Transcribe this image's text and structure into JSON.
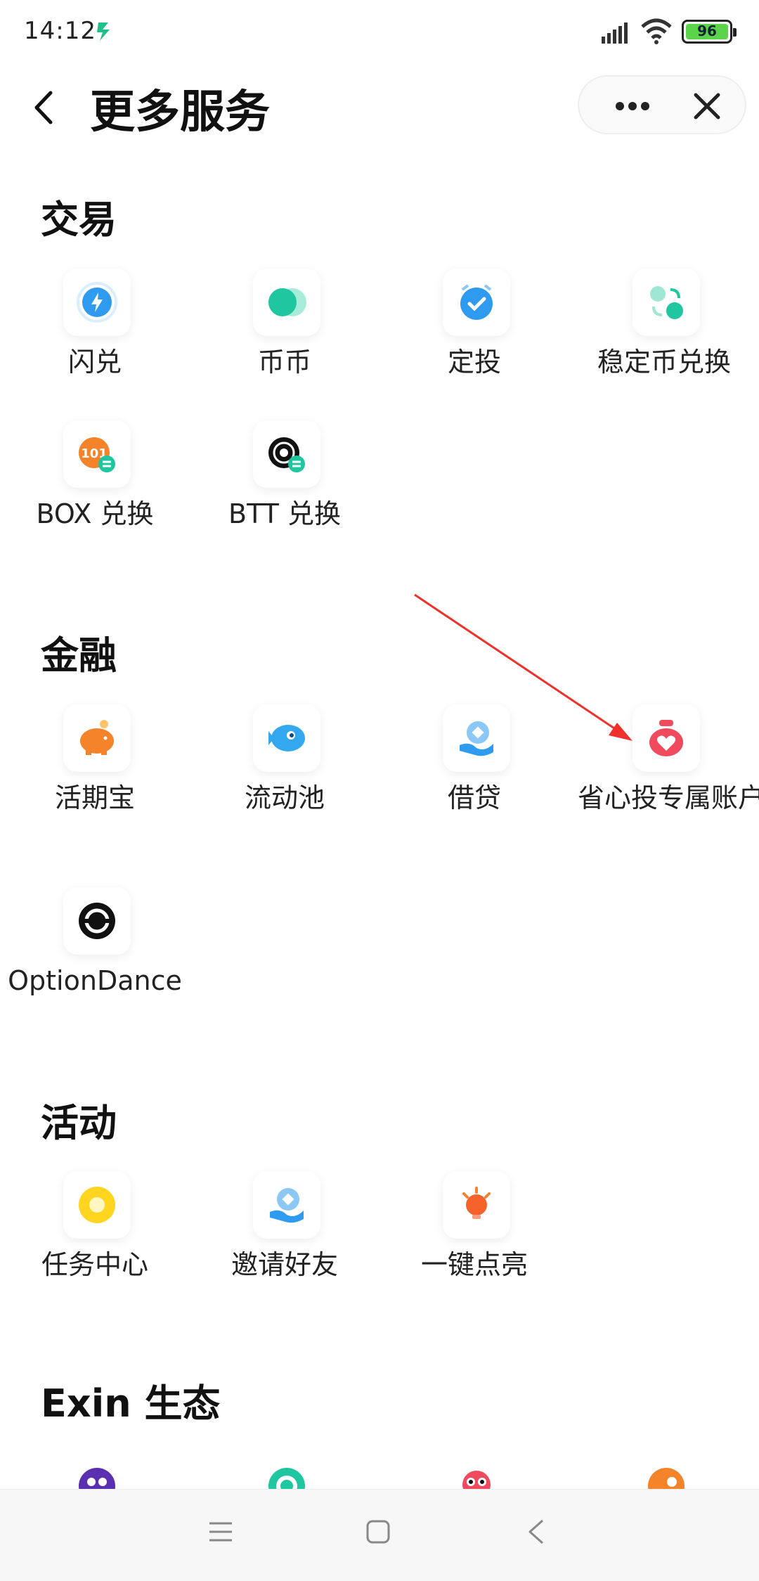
{
  "status_bar": {
    "time": "14:12",
    "battery": "96"
  },
  "header": {
    "title": "更多服务"
  },
  "sections": [
    {
      "title": "交易",
      "items": [
        {
          "label": "闪兑",
          "icon": "flash-swap-icon"
        },
        {
          "label": "币币",
          "icon": "coin-coin-icon"
        },
        {
          "label": "定投",
          "icon": "auto-invest-icon"
        },
        {
          "label": "稳定币兑换",
          "icon": "stablecoin-swap-icon"
        },
        {
          "label": "BOX 兑换",
          "icon": "box-swap-icon"
        },
        {
          "label": "BTT 兑换",
          "icon": "btt-swap-icon"
        }
      ]
    },
    {
      "title": "金融",
      "items": [
        {
          "label": "活期宝",
          "icon": "piggy-bank-icon"
        },
        {
          "label": "流动池",
          "icon": "liquidity-pool-icon"
        },
        {
          "label": "借贷",
          "icon": "lending-icon"
        },
        {
          "label": "省心投专属账户",
          "icon": "money-bag-icon"
        },
        {
          "label": "OptionDance",
          "icon": "optiondance-icon"
        }
      ]
    },
    {
      "title": "活动",
      "items": [
        {
          "label": "任务中心",
          "icon": "task-center-icon"
        },
        {
          "label": "邀请好友",
          "icon": "invite-friends-icon"
        },
        {
          "label": "一键点亮",
          "icon": "light-up-icon"
        }
      ]
    },
    {
      "title": "Exin 生态",
      "items": []
    }
  ],
  "colors": {
    "accent_blue": "#2e9bf0",
    "accent_green": "#1fc6a0",
    "accent_orange": "#f5832a",
    "accent_red": "#f04a5f",
    "annotation_arrow": "#f0312b"
  }
}
